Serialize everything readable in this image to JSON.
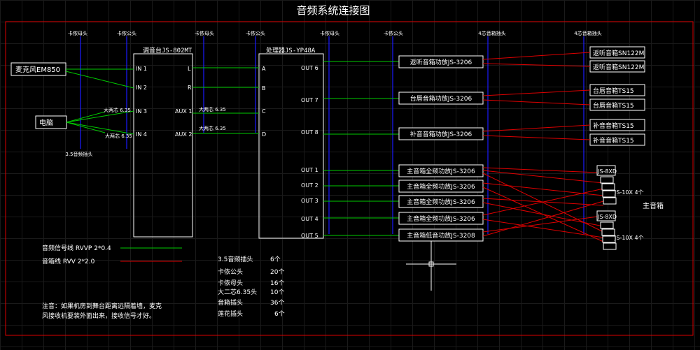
{
  "title": "音频系统连接图",
  "connector_labels": [
    "卡侬母头",
    "卡侬公头",
    "卡侬母头",
    "卡侬公头",
    "卡侬母头",
    "卡侬公头",
    "4芯音箱插头",
    "4芯音箱插头"
  ],
  "jack_label": "3.5音频插头",
  "sources": {
    "mic": "麦克风EM850",
    "pc": "电脑"
  },
  "mixer": {
    "title": "调音台JS-802MT",
    "inputs": [
      "IN 1",
      "IN 2",
      "IN 3",
      "IN 4"
    ],
    "outputs": [
      "L",
      "R",
      "AUX 1",
      "AUX 2"
    ]
  },
  "processor": {
    "title": "处理器JS-YP48A",
    "inputs": [
      "A",
      "B",
      "C",
      "D"
    ],
    "outputs": [
      "OUT 6",
      "OUT 7",
      "OUT 8",
      "OUT 1",
      "OUT 2",
      "OUT 3",
      "OUT 4",
      "OUT 5"
    ]
  },
  "cable_labels": {
    "pc_in3": "大两芯 6.35",
    "pc_in4": "大两芯 6.35",
    "aux1": "大两芯 6.35",
    "aux2": "大两芯 6.35"
  },
  "amps": [
    "返听音箱功放JS-3206",
    "台唇音箱功放JS-3206",
    "补音音箱功放JS-3206",
    "主音箱全频功放JS-3206",
    "主音箱全频功放JS-3206",
    "主音箱全频功放JS-3206",
    "主音箱全频功放JS-3206",
    "主音箱低音功放JS-3208"
  ],
  "speakers": [
    "返听音箱SN122M",
    "返听音箱SN122M",
    "台唇音箱TS15",
    "台唇音箱TS15",
    "补音音箱TS15",
    "补音音箱TS15"
  ],
  "main_speakers": {
    "sub_top": "JS-8XD",
    "arr_top": "JS-10X 4个",
    "sub_bottom": "JS-8XD",
    "arr_bottom": "JS-10X 4个",
    "label": "主音箱"
  },
  "legend": [
    {
      "label": "音频信号线 RVVP 2*0.4",
      "color": "#00cc00"
    },
    {
      "label": "音箱线 RVV  2*2.0",
      "color": "#dd0000"
    }
  ],
  "bom": [
    {
      "item": "3.5音频插头",
      "qty": "6个"
    },
    {
      "item": "卡侬公头",
      "qty": "20个"
    },
    {
      "item": "卡侬母头",
      "qty": "16个"
    },
    {
      "item": "大二芯6.35头",
      "qty": "10个"
    },
    {
      "item": "音箱插头",
      "qty": "36个"
    },
    {
      "item": "莲花插头",
      "qty": "6个"
    }
  ],
  "note": [
    "注音：如果机房到舞台距离远隔着墙，麦克",
    "风接收机要装外面出来，接收信号才好。"
  ],
  "colors": {
    "signal": "#00cc00",
    "speaker": "#dd0000",
    "plug": "#1c1cff",
    "frame": "#dd0000",
    "box": "#ffffff"
  }
}
